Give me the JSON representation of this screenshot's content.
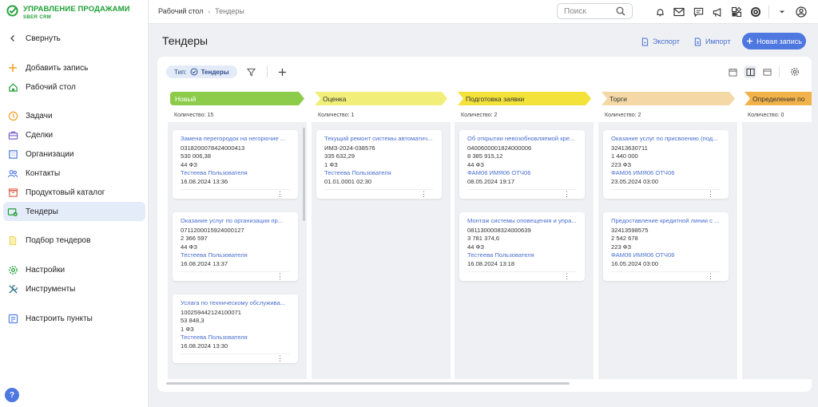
{
  "app": {
    "name_line1": "УПРАВЛЕНИЕ ПРОДАЖАМИ",
    "name_line2": "SBER CRM",
    "brand_color": "#21a038"
  },
  "sidebar": {
    "items": [
      {
        "label": "Свернуть",
        "icon": "chevron-left-icon"
      },
      {
        "label": "Добавить запись",
        "icon": "plus-icon"
      },
      {
        "label": "Рабочий стол",
        "icon": "home-icon"
      },
      {
        "label": "Задачи",
        "icon": "clock-icon"
      },
      {
        "label": "Сделки",
        "icon": "briefcase-icon"
      },
      {
        "label": "Организации",
        "icon": "building-icon"
      },
      {
        "label": "Контакты",
        "icon": "people-icon"
      },
      {
        "label": "Продуктовый каталог",
        "icon": "box-icon"
      },
      {
        "label": "Тендеры",
        "icon": "tender-icon",
        "active": true
      },
      {
        "label": "Подбор тендеров",
        "icon": "document-icon"
      },
      {
        "label": "Настройки",
        "icon": "gear-icon"
      },
      {
        "label": "Инструменты",
        "icon": "tools-icon"
      },
      {
        "label": "Настроить пункты",
        "icon": "configure-icon"
      }
    ],
    "help_label": "?"
  },
  "header": {
    "breadcrumb": [
      "Рабочий стол",
      "Тендеры"
    ],
    "search_placeholder": "Поиск"
  },
  "page": {
    "title": "Тендеры",
    "export_label": "Экспорт",
    "import_label": "Импорт",
    "new_label": "Новая запись",
    "accent_color": "#4e77e0"
  },
  "filter": {
    "prefix": "Тип:",
    "value": "Тендеры"
  },
  "columns": [
    {
      "name": "Новый",
      "color": "#8ccc4a",
      "count_text": "Количество: 15",
      "cards": [
        {
          "title": "Замена перегородок на негорючие ...",
          "number": "0318200078424000413",
          "amount": "530 006,38",
          "law": "44 ФЗ",
          "person": "Тестеева Пользователя",
          "date": "16.08.2024 13:36"
        },
        {
          "title": "Оказание услуг по организации пр...",
          "number": "0711200015924000127",
          "amount": "2 366 597",
          "law": "44 ФЗ",
          "person": "Тестеева Пользователя",
          "date": "16.08.2024 13:37"
        },
        {
          "title": "Услага по техническому обслужива...",
          "number": "100259442124100071",
          "amount": "53 848,3",
          "law": "1 ФЗ",
          "person": "Тестеева Пользователя",
          "date": "16.08.2024 13:30"
        }
      ]
    },
    {
      "name": "Оценка",
      "color": "#f1ef7a",
      "count_text": "Количество: 1",
      "cards": [
        {
          "title": "Текущий ремонт системы автоматич...",
          "number": "ИМЗ-2024-038576",
          "amount": "335 632,29",
          "law": "1 ФЗ",
          "person": "Тестеева Пользователя",
          "date": "01.01.0001 02:30"
        }
      ]
    },
    {
      "name": "Подготовка заявки",
      "color": "#f2e23a",
      "count_text": "Количество: 2",
      "cards": [
        {
          "title": "Об открытии невозобновляемой кре...",
          "number": "0400600001824000006",
          "amount": "8 385 915,12",
          "law": "44 ФЗ",
          "person": "ФАМ06 ИМЯ06 ОТЧ06",
          "date": "08.05.2024 19:17"
        },
        {
          "title": "Монтаж системы оповещения и упра...",
          "number": "0811300008324000639",
          "amount": "3 781 374,6",
          "law": "44 ФЗ",
          "person": "Тестеева Пользователя",
          "date": "16.08.2024 13:18"
        }
      ]
    },
    {
      "name": "Торги",
      "color": "#f4d9a6",
      "count_text": "Количество: 2",
      "cards": [
        {
          "title": "Оказание услуг по присвоению (под...",
          "number": "32413630711",
          "amount": "1 440 000",
          "law": "223 ФЗ",
          "person": "ФАМ06 ИМЯ06 ОТЧ06",
          "date": "23.05.2024 03:00"
        },
        {
          "title": "Предоставление кредитной линии с ...",
          "number": "32413598575",
          "amount": "2 542 678",
          "law": "223 ФЗ",
          "person": "ФАМ06 ИМЯ06 ОТЧ06",
          "date": "16.05.2024 03:00"
        }
      ]
    },
    {
      "name": "Определение по",
      "color": "#f2b24a",
      "count_text": "Количество: 0",
      "cards": []
    }
  ],
  "card_menu_glyph": "⋮"
}
